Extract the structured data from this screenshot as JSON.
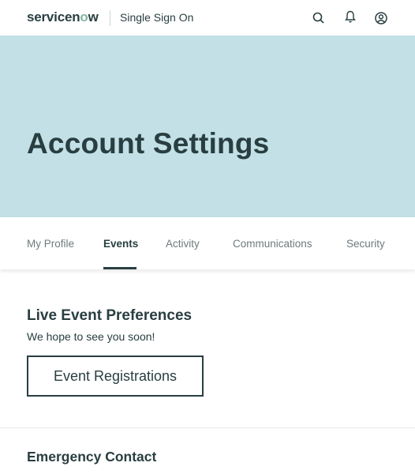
{
  "header": {
    "logo_text_pre": "servicen",
    "logo_text_o": "o",
    "logo_text_post": "w",
    "app_name": "Single Sign On",
    "icons": [
      "search-icon",
      "bell-icon",
      "user-icon"
    ]
  },
  "hero": {
    "title": "Account Settings",
    "background": "#c2e0e6"
  },
  "tabs": [
    {
      "label": "My Profile",
      "active": false
    },
    {
      "label": "Events",
      "active": true
    },
    {
      "label": "Activity",
      "active": false
    },
    {
      "label": "Communications",
      "active": false
    },
    {
      "label": "Security",
      "active": false
    }
  ],
  "live_events": {
    "title": "Live Event Preferences",
    "subtitle": "We hope to see you soon!",
    "button_label": "Event Registrations"
  },
  "emergency": {
    "title": "Emergency Contact"
  },
  "colors": {
    "text": "#293e40",
    "muted": "#6e7a7c",
    "accent": "#81b5a1"
  }
}
